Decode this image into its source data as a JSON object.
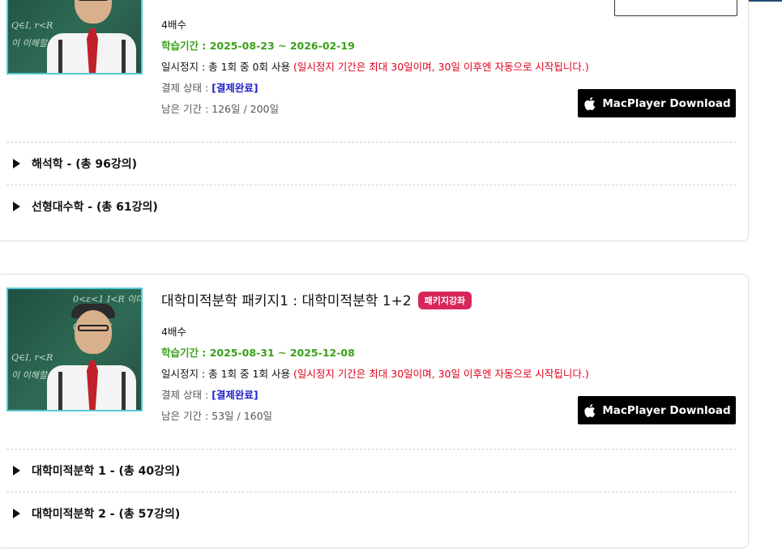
{
  "courses": [
    {
      "title": "",
      "badge": "",
      "multiplier": "4배수",
      "study_period": "학습기간 : 2025-08-23 ~ 2026-02-19",
      "pause_info": "일시정지 : 총 1회 중 0회 사용",
      "pause_warning": "(일시정지 기간은 최대 30일이며, 30일 이후엔 자동으로 시작됩니다.)",
      "payment_label": "결제 상태 :",
      "payment_status": "[결제완료]",
      "remaining": "남은 기간 : 126일 / 200일",
      "mac_button": "MacPlayer Download",
      "lectures": [
        {
          "label": "해석학 - (총 96강의)"
        },
        {
          "label": "선형대수학 - (총 61강의)"
        }
      ]
    },
    {
      "title": "대학미적분학 패키지1 : 대학미적분학 1+2",
      "badge": "패키지강좌",
      "multiplier": "4배수",
      "study_period": "학습기간 : 2025-08-31 ~ 2025-12-08",
      "pause_info": "일시정지 : 총 1회 중 1회 사용",
      "pause_warning": "(일시정지 기간은 최대 30일이며, 30일 이후엔 자동으로 시작됩니다.)",
      "payment_label": "결제 상태 :",
      "payment_status": "[결제완료]",
      "remaining": "남은 기간 : 53일 / 160일",
      "mac_button": "MacPlayer Download",
      "lectures": [
        {
          "label": "대학미적분학 1 - (총 40강의)"
        },
        {
          "label": "대학미적분학 2 - (총 57강의)"
        }
      ]
    }
  ],
  "icons": {
    "apple": "apple-icon",
    "expand": "triangle-right-icon"
  },
  "colors": {
    "period_green": "#3aa11a",
    "warning_red": "#e0001b",
    "payment_blue": "#2222cc",
    "badge_pink": "#d8265a",
    "button_black": "#000000"
  }
}
